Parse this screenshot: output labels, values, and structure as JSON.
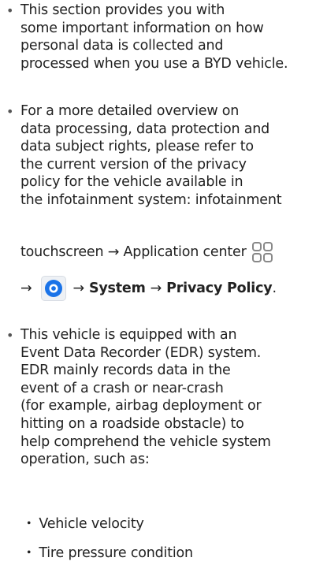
{
  "bullet_char": "•",
  "section1": {
    "lines": [
      "This section provides you with",
      "some important information on how",
      "personal data is collected and",
      "processed when you use a BYD vehicle."
    ]
  },
  "section2": {
    "lines": [
      "For a more detailed overview on",
      "data processing, data protection and",
      "data subject rights, please refer to",
      "the current version of the privacy",
      "policy for the vehicle available in",
      "the infotainment system: infotainment"
    ],
    "touch_line": "touchscreen → Application center",
    "arrow1": "→",
    "arrow2": "→",
    "system_label": "System",
    "arrow3": "→",
    "privacy_label": "Privacy Policy",
    "period": ".",
    "app_center_icon": "apps-grid-icon",
    "settings_icon": "settings-gear-icon"
  },
  "section3": {
    "lines": [
      "This vehicle is equipped with an",
      "Event Data Recorder (EDR) system.",
      "EDR mainly records data in the",
      "event of a crash or near-crash",
      "(for example, airbag deployment or",
      "hitting on a roadside obstacle) to",
      "help comprehend the vehicle system",
      "operation, such as:"
    ],
    "items": [
      "Vehicle velocity",
      "Tire pressure condition"
    ],
    "item_marker": "・"
  },
  "colors": {
    "text": "#222222",
    "gear_blue": "#1a73e8",
    "icon_gray": "#888888"
  }
}
